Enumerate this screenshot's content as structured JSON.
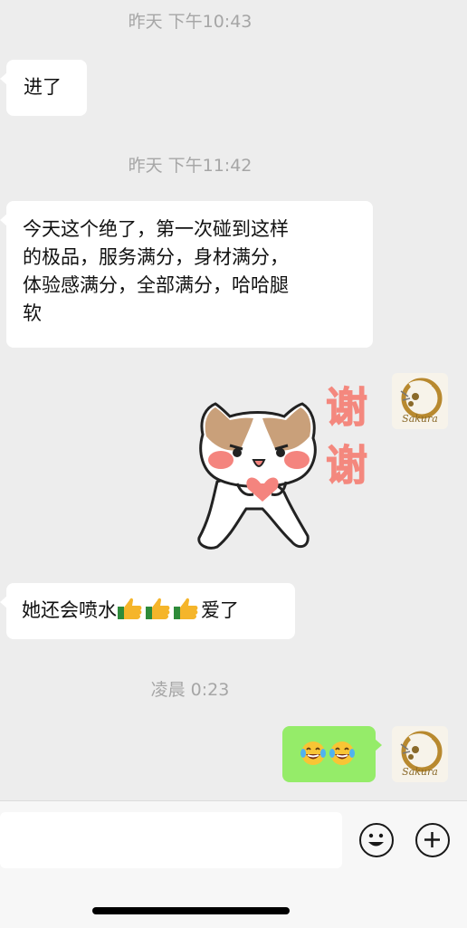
{
  "messages": [
    {
      "type": "timestamp",
      "text": "昨天 下午10:43"
    },
    {
      "type": "text",
      "side": "left",
      "text": "进了"
    },
    {
      "type": "timestamp",
      "text": "昨天 下午11:42"
    },
    {
      "type": "text",
      "side": "left",
      "lines": [
        "今天这个绝了，第一次碰到这样",
        "的极品，服务满分，身材满分，",
        "体验感满分，全部满分，哈哈腿",
        "软"
      ]
    },
    {
      "type": "sticker",
      "side": "right",
      "text": [
        "谢",
        "谢"
      ],
      "icon": "cat-thanks-sticker"
    },
    {
      "type": "text",
      "side": "left",
      "text_before": "她还会喷水",
      "emojis": [
        "thumbs-up",
        "thumbs-up",
        "thumbs-up"
      ],
      "text_after": "爱了"
    },
    {
      "type": "timestamp",
      "text": "凌晨 0:23"
    },
    {
      "type": "emoji",
      "side": "right",
      "emojis": [
        "tears-of-joy",
        "tears-of-joy"
      ]
    }
  ],
  "avatar": {
    "text": "Sakura"
  },
  "input": {
    "value": "",
    "emoji_icon": "smiley-icon",
    "plus_icon": "plus-icon"
  }
}
